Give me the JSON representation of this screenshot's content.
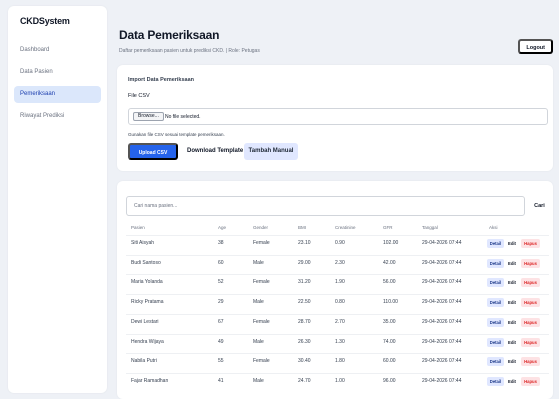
{
  "sidebar": {
    "brand": "CKDSystem",
    "items": [
      {
        "label": "Dashboard",
        "active": false
      },
      {
        "label": "Data Pasien",
        "active": false
      },
      {
        "label": "Pemeriksaan",
        "active": true
      },
      {
        "label": "Riwayat Prediksi",
        "active": false
      }
    ]
  },
  "header": {
    "title": "Data Pemeriksaan",
    "subtitle": "Daftar pemeriksaan pasien untuk prediksi CKD. | Role: Petugas",
    "logout_label": "Logout"
  },
  "import": {
    "title": "Import Data Pemeriksaan",
    "file_label": "File CSV",
    "browse_label": "Browse...",
    "file_status": "No file selected.",
    "hint": "Gunakan file CSV sesuai template pemeriksaan.",
    "upload_label": "Upload CSV",
    "download_label": "Download Template",
    "manual_label": "Tambah Manual"
  },
  "search": {
    "placeholder": "Cari nama pasien...",
    "button_label": "Cari"
  },
  "table": {
    "headers": [
      "Pasien",
      "Age",
      "Gender",
      "BMI",
      "Creatinine",
      "GFR",
      "Tanggal",
      "Aksi"
    ],
    "action_labels": {
      "detail": "Detail",
      "edit": "Edit",
      "delete": "Hapus"
    },
    "rows": [
      {
        "pasien": "Siti Aisyah",
        "age": "38",
        "gender": "Female",
        "bmi": "23.10",
        "creatinine": "0.90",
        "gfr": "102.00",
        "tanggal": "29-04-2026 07:44"
      },
      {
        "pasien": "Budi Santoso",
        "age": "60",
        "gender": "Male",
        "bmi": "29.00",
        "creatinine": "2.30",
        "gfr": "42.00",
        "tanggal": "29-04-2026 07:44"
      },
      {
        "pasien": "Maria Yolanda",
        "age": "52",
        "gender": "Female",
        "bmi": "31.20",
        "creatinine": "1.90",
        "gfr": "56.00",
        "tanggal": "29-04-2026 07:44"
      },
      {
        "pasien": "Ricky Pratama",
        "age": "29",
        "gender": "Male",
        "bmi": "22.50",
        "creatinine": "0.80",
        "gfr": "110.00",
        "tanggal": "29-04-2026 07:44"
      },
      {
        "pasien": "Dewi Lestari",
        "age": "67",
        "gender": "Female",
        "bmi": "28.70",
        "creatinine": "2.70",
        "gfr": "35.00",
        "tanggal": "29-04-2026 07:44"
      },
      {
        "pasien": "Hendra Wijaya",
        "age": "49",
        "gender": "Male",
        "bmi": "26.30",
        "creatinine": "1.30",
        "gfr": "74.00",
        "tanggal": "29-04-2026 07:44"
      },
      {
        "pasien": "Nabila Putri",
        "age": "55",
        "gender": "Female",
        "bmi": "30.40",
        "creatinine": "1.80",
        "gfr": "60.00",
        "tanggal": "29-04-2026 07:44"
      },
      {
        "pasien": "Fajar Ramadhan",
        "age": "41",
        "gender": "Male",
        "bmi": "24.70",
        "creatinine": "1.00",
        "gfr": "96.00",
        "tanggal": "29-04-2026 07:44"
      }
    ]
  },
  "colors": {
    "primary": "#2563eb",
    "active_nav_bg": "#dbe7fb",
    "danger": "#dc2626",
    "danger_bg": "#fde2e4",
    "detail_bg": "#e0e7ff",
    "page_bg": "#eef1f6"
  }
}
